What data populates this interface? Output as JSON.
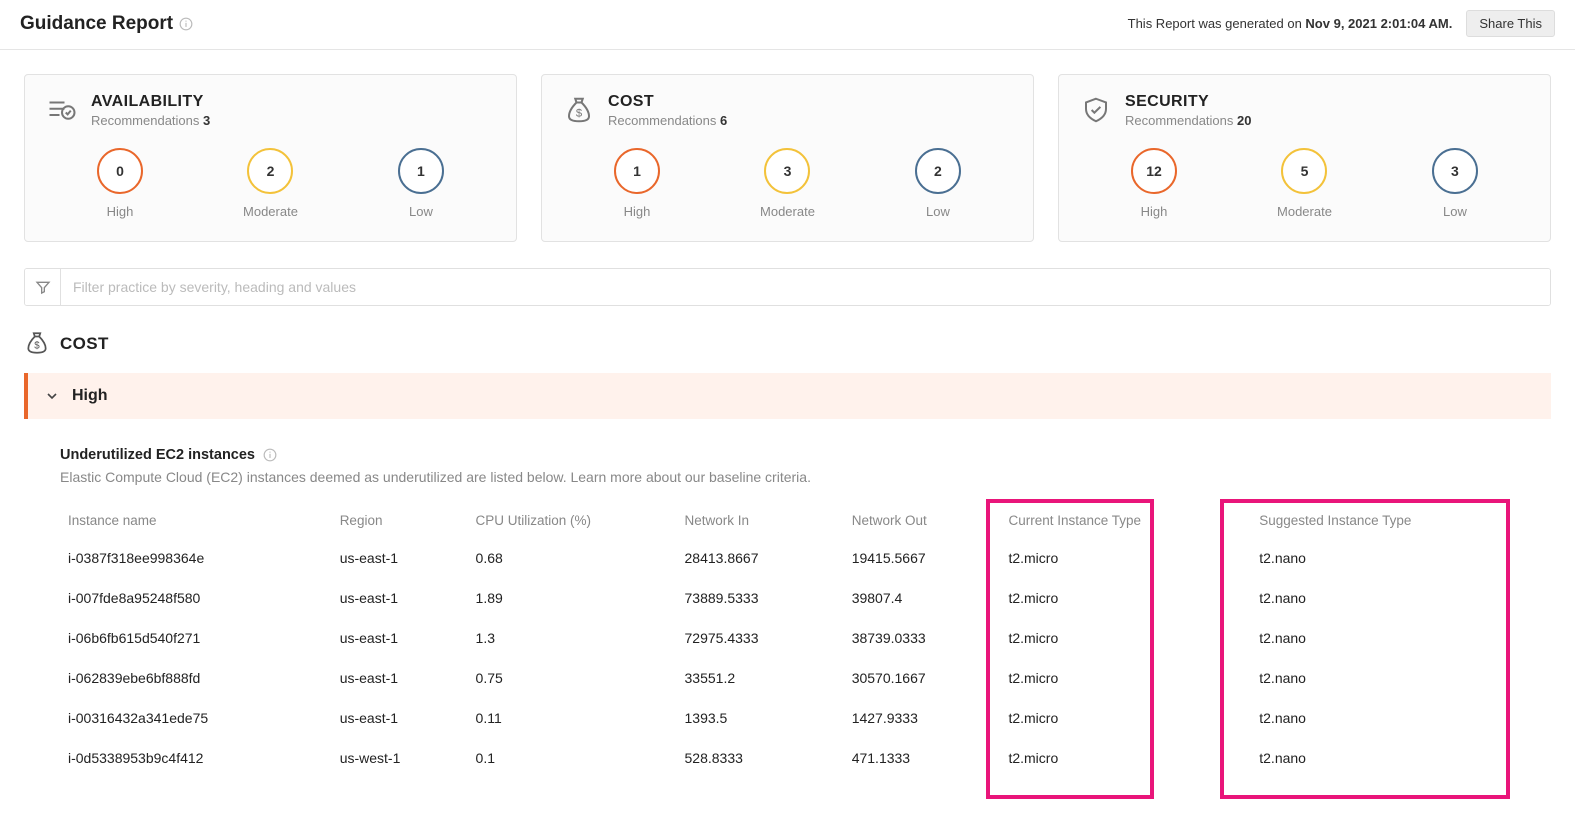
{
  "header": {
    "title": "Guidance Report",
    "generated_prefix": "This Report was generated on ",
    "generated_date": "Nov 9, 2021 2:01:04 AM.",
    "share_label": "Share This"
  },
  "cards": [
    {
      "key": "availability",
      "title": "AVAILABILITY",
      "rec_label": "Recommendations",
      "rec_count": "3",
      "metrics": [
        {
          "v": "0",
          "l": "High"
        },
        {
          "v": "2",
          "l": "Moderate"
        },
        {
          "v": "1",
          "l": "Low"
        }
      ]
    },
    {
      "key": "cost",
      "title": "COST",
      "rec_label": "Recommendations",
      "rec_count": "6",
      "metrics": [
        {
          "v": "1",
          "l": "High"
        },
        {
          "v": "3",
          "l": "Moderate"
        },
        {
          "v": "2",
          "l": "Low"
        }
      ]
    },
    {
      "key": "security",
      "title": "SECURITY",
      "rec_label": "Recommendations",
      "rec_count": "20",
      "metrics": [
        {
          "v": "12",
          "l": "High"
        },
        {
          "v": "5",
          "l": "Moderate"
        },
        {
          "v": "3",
          "l": "Low"
        }
      ]
    }
  ],
  "filter": {
    "placeholder": "Filter practice by severity, heading and values"
  },
  "section": {
    "title": "COST",
    "severity": "High"
  },
  "detail": {
    "title": "Underutilized EC2 instances",
    "desc": "Elastic Compute Cloud (EC2) instances deemed as underutilized are listed below. Learn more about our baseline criteria.",
    "columns": [
      "Instance name",
      "Region",
      "CPU Utilization (%)",
      "Network In",
      "Network Out",
      "Current Instance Type",
      "Suggested Instance Type"
    ],
    "rows": [
      [
        "i-0387f318ee998364e",
        "us-east-1",
        "0.68",
        "28413.8667",
        "19415.5667",
        "t2.micro",
        "t2.nano"
      ],
      [
        "i-007fde8a95248f580",
        "us-east-1",
        "1.89",
        "73889.5333",
        "39807.4",
        "t2.micro",
        "t2.nano"
      ],
      [
        "i-06b6fb615d540f271",
        "us-east-1",
        "1.3",
        "72975.4333",
        "38739.0333",
        "t2.micro",
        "t2.nano"
      ],
      [
        "i-062839ebe6bf888fd",
        "us-east-1",
        "0.75",
        "33551.2",
        "30570.1667",
        "t2.micro",
        "t2.nano"
      ],
      [
        "i-00316432a341ede75",
        "us-east-1",
        "0.11",
        "1393.5",
        "1427.9333",
        "t2.micro",
        "t2.nano"
      ],
      [
        "i-0d5338953b9c4f412",
        "us-west-1",
        "0.1",
        "528.8333",
        "471.1333",
        "t2.micro",
        "t2.nano"
      ]
    ]
  }
}
